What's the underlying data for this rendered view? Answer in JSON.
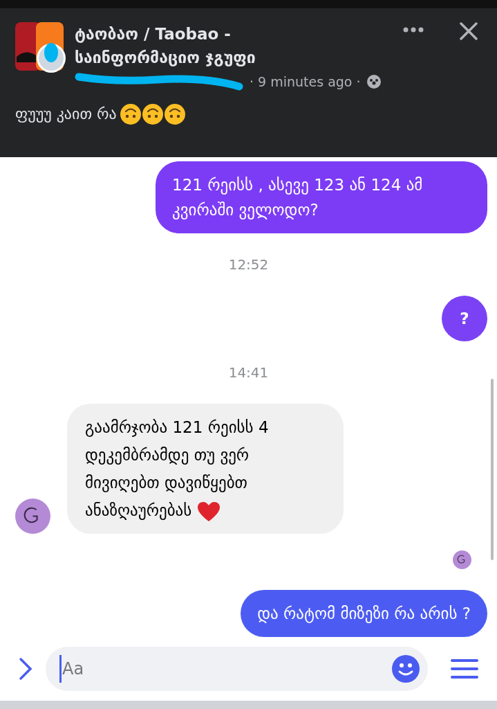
{
  "post": {
    "title_lines": [
      "ტაობაო / Taobao -",
      "საინფორმაციო ჯგუფი"
    ],
    "meta": "· 9 minutes ago ·",
    "text": "ფუუუ კაით რა",
    "emojis": [
      {
        "kind": "upside-down-face"
      },
      {
        "kind": "upside-down-face"
      },
      {
        "kind": "upside-down-face"
      }
    ]
  },
  "messages": [
    {
      "kind": "outgoing",
      "text": "121 რეისს , ასევე 123 ან 124 ამ კვირაში ველოდო?",
      "color": "#7c3cf5"
    },
    {
      "kind": "timestamp",
      "text": "12:52"
    },
    {
      "kind": "outgoing-round",
      "text": "?",
      "color": "#7a42f4"
    },
    {
      "kind": "timestamp",
      "text": "14:41"
    },
    {
      "kind": "incoming",
      "text": "გაამრჯობა 121 რეისს 4 დეკემბრამდე თუ ვერ მივიღებთ დავიწყებთ ანაზღაურებას",
      "emojis": [
        {
          "kind": "heart"
        }
      ]
    },
    {
      "kind": "seen"
    },
    {
      "kind": "outgoing",
      "text": "და რატომ მიზეზი რა არის ?",
      "color": "#4c5cf2"
    }
  ],
  "composer": {
    "placeholder": "Aa"
  }
}
